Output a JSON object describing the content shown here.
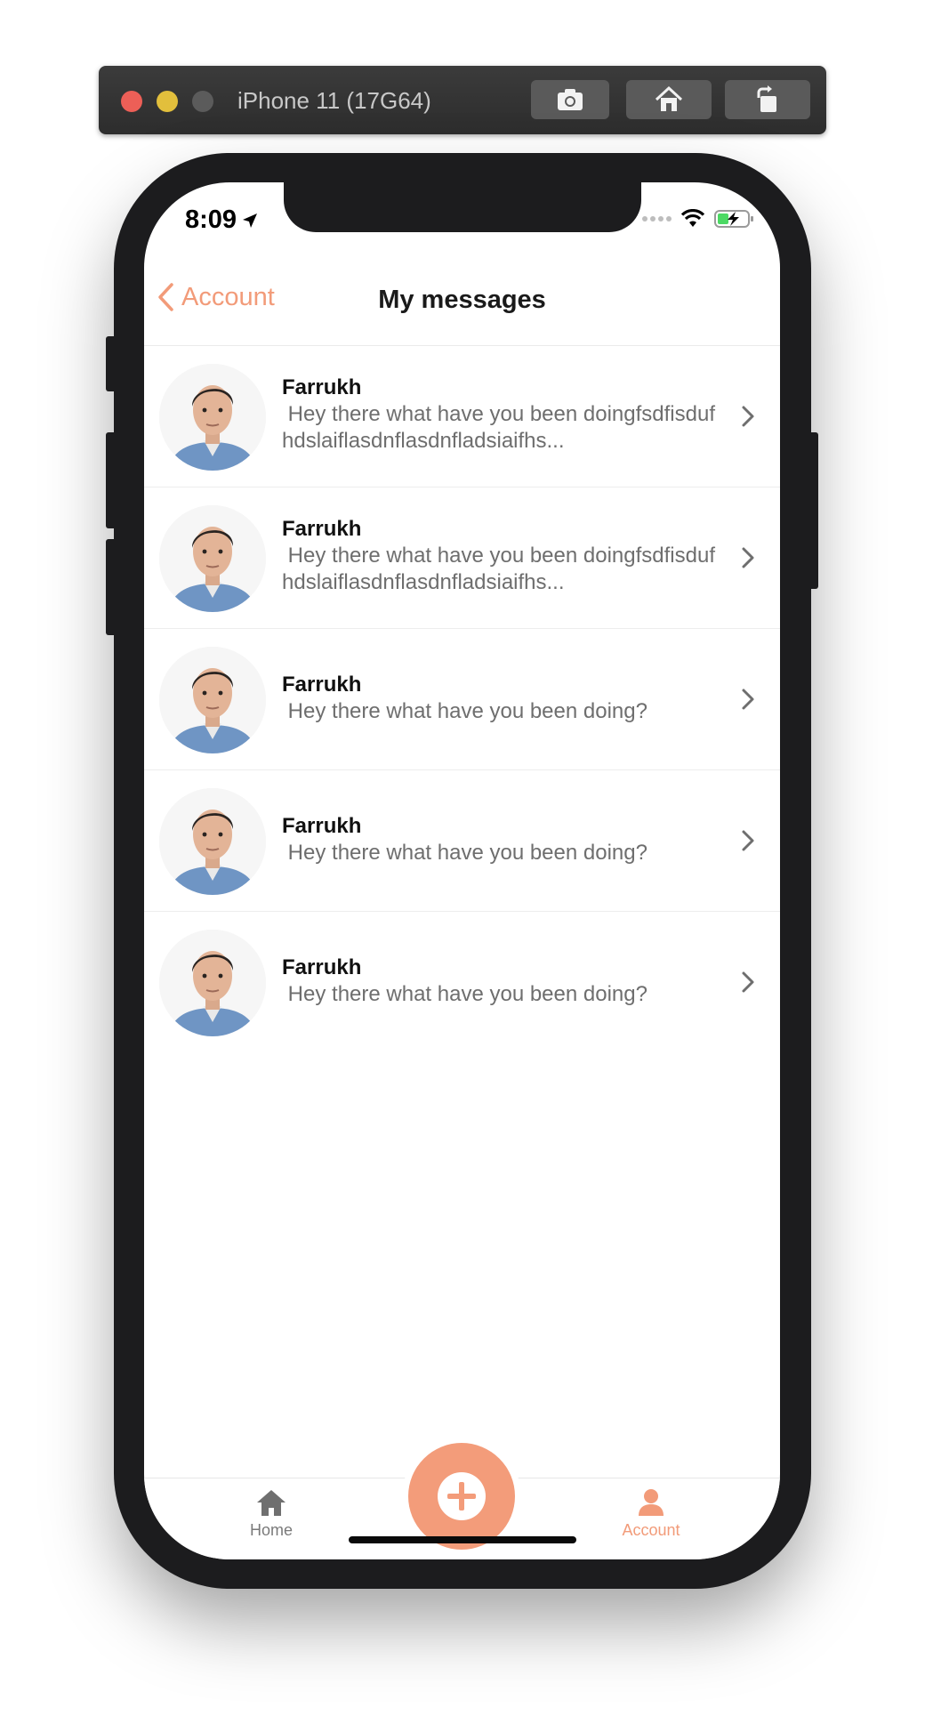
{
  "simulator": {
    "title": "iPhone 11 (17G64)",
    "buttons": [
      "screenshot-icon",
      "home-icon",
      "rotate-icon"
    ]
  },
  "status_bar": {
    "time": "8:09"
  },
  "nav": {
    "back_label": "Account",
    "title": "My messages"
  },
  "messages": [
    {
      "name": "Farrukh",
      "text": " Hey there what have you been doingfsdfisdufhdslaiflasdnflasdnfladsiaifhs..."
    },
    {
      "name": "Farrukh",
      "text": " Hey there what have you been doingfsdfisdufhdslaiflasdnflasdnfladsiaifhs..."
    },
    {
      "name": "Farrukh",
      "text": " Hey there what have you been doing?"
    },
    {
      "name": "Farrukh",
      "text": " Hey there what have you been doing?"
    },
    {
      "name": "Farrukh",
      "text": " Hey there what have you been doing?"
    }
  ],
  "tabbar": {
    "home_label": "Home",
    "account_label": "Account"
  },
  "colors": {
    "accent": "#f29b79",
    "fab": "#f39c7a"
  }
}
